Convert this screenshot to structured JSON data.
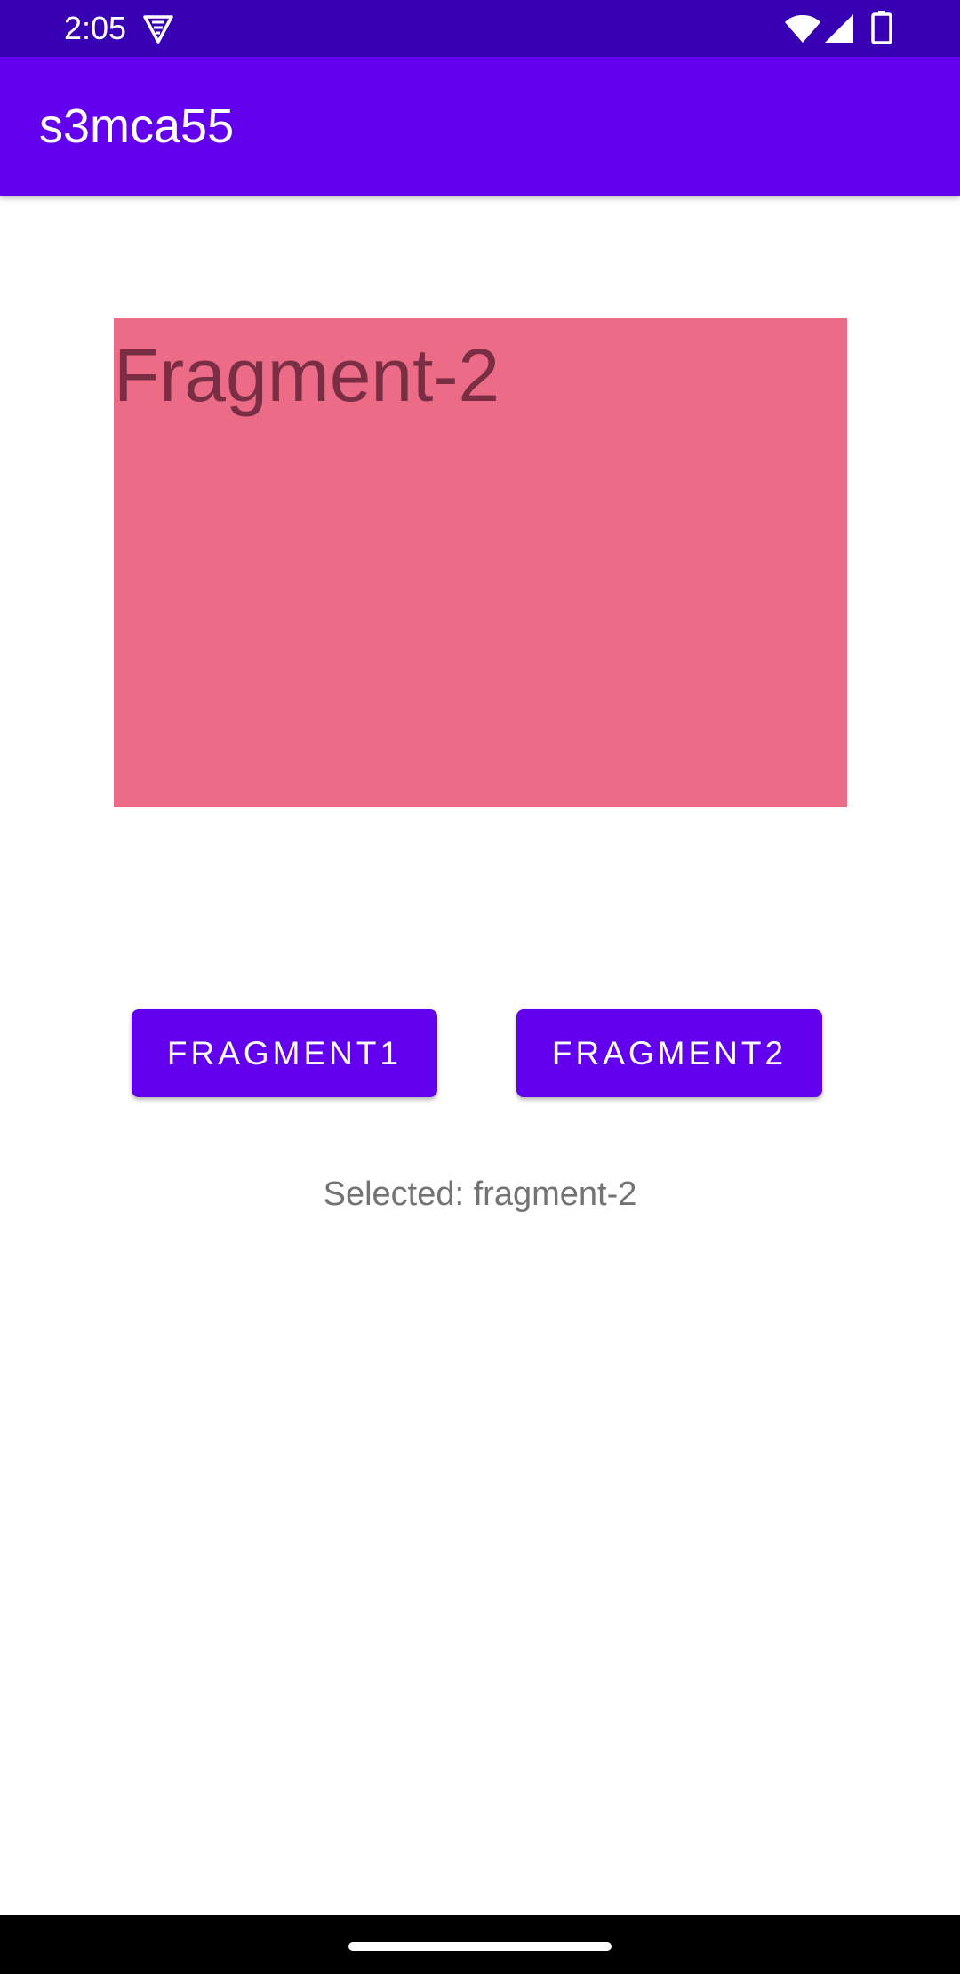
{
  "status_bar": {
    "time": "2:05",
    "icons": [
      "vpn-key-icon",
      "wifi-icon",
      "cell-signal-icon",
      "battery-icon"
    ]
  },
  "app_bar": {
    "title": "s3mca55"
  },
  "fragment": {
    "label": "Fragment-2",
    "background_color": "#ec6b87"
  },
  "buttons": {
    "fragment1_label": "FRAGMENT1",
    "fragment2_label": "FRAGMENT2"
  },
  "selected_text": "Selected: fragment-2",
  "colors": {
    "primary": "#6200ee",
    "primary_dark": "#3700b3"
  }
}
